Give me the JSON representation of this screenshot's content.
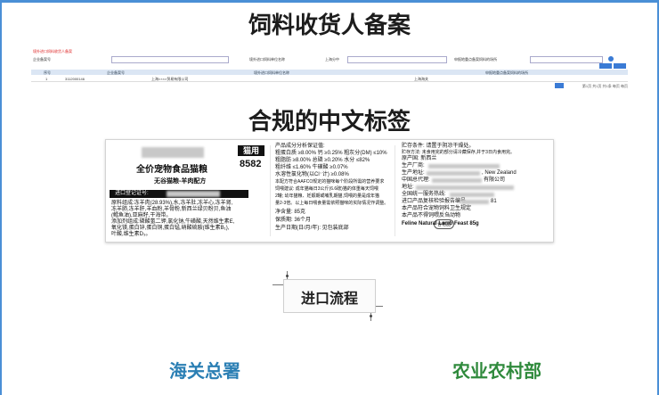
{
  "titles": {
    "section1": "饲料收货人备案",
    "section2": "合规的中文标签"
  },
  "system": {
    "heading": "境外进口饲料收货人备案",
    "filters": [
      "企业备案号",
      "境外进口饲料单位名称",
      "上海分中",
      "申报地重点备案饲料的场所",
      "中文地址"
    ],
    "columns": [
      "序号",
      "企业备案号",
      "境外进口饲料单位名称",
      "申报地重点备案饲料的场所"
    ],
    "rows": [
      [
        "1",
        "3112000146",
        "上海××××贸易有限公司",
        "上海海关"
      ]
    ],
    "pager": "第1页 共1页 共1条 每页 每页"
  },
  "pet_label": {
    "type_badge": "猫用",
    "code": "8582",
    "product_line1": "全价宠物食品猫粮",
    "product_line2": "无谷猫粮-羊肉配方",
    "reg_no_label": "进口登记证号:",
    "ingredients": [
      "原料组成:冻羊肉(28.93%),水,冻羊肚,冻羊心,冻羊肾,",
      "冻羊肺,冻羊肝,羊血粉,羊骨粉,新西兰绿贝粉贝,鱼油",
      "(鳕鱼油),亚麻籽,干海带。",
      "添加剂组成:磷酸氢二钾,氯化钠,牛磺酸,天然维生素E,",
      "氧化镁,蛋白锌,蛋白铜,蛋白锰,硝酸硫胺(维生素B₁),",
      "叶酸,维生素D₃。"
    ],
    "analysis": [
      "产品成分分析保证值:",
      "粗蛋白质 ≥8.00% 钙 ≥0.25% 粗灰分(DM) ≤10%",
      "粗脂肪 ≥8.00% 总磷 ≥0.20% 水分 ≤82%",
      "粗纤维 ≤1.60% 牛磺酸 ≥0.07%",
      "水溶性氯化物(以Cl⁻计) ≥0.08%",
      "本配方符合AAFCO规定的猫咪每个阶段所需的营养要求",
      "饲喂建议: 成年猫每日3公斤(6.6磅)猫的体重每天饲喂",
      "2罐; 幼年猫粮、妊娠期或哺乳期猫,饲喂的量是成年猫",
      "量2-3倍。以上每日喂食量需依照猫咪的实际情况作调整。",
      "净含量: 85克",
      "保质期: 36个月",
      "生产日期(日/月/年): 见包装底部"
    ],
    "stamp": "合格品",
    "storage": [
      "贮存条件: 请置于阴凉干燥处。",
      "贮存方法: 未食用完的部分请冷藏保存,并于3日内食用完。",
      "原产国: 新西兰",
      "生产厂商:",
      "生产地址:",
      "中国总代理:",
      "地址:",
      "全国统一服务热线:",
      "进口产品复核检验报告编号",
      "本产品符合宠物饲料卫生规定",
      "本产品不得饲喂反刍动物",
      "Feline Natural Lamb Feast 85g"
    ],
    "address_suffix": ", New Zealand",
    "agent_suffix": "有限公司",
    "report_suffix": "81"
  },
  "process_label": "进口流程",
  "orgs": {
    "left": "海关总署",
    "right": "农业农村部"
  },
  "colors": {
    "frame": "#4a8fd6",
    "left_org": "#2b7fb4",
    "right_org": "#2f8a3c"
  }
}
